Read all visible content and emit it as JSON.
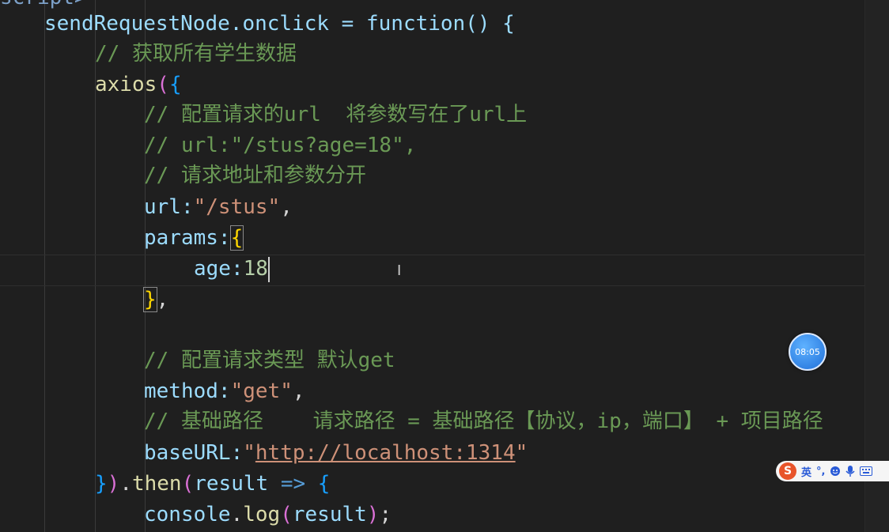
{
  "editor": {
    "l0": "sendRequestNode.onclick = function() {",
    "c1": "// 获取所有学生数据",
    "axios": "axios",
    "c2": "// 配置请求的url  将参数写在了url上",
    "c3": "// url:\"/stus?age=18\",",
    "c4": "// 请求地址和参数分开",
    "url_key": "url:",
    "url_val": "\"/stus\"",
    "params_key": "params:",
    "age_key": "age:",
    "age_val": "18",
    "c5": "// 配置请求类型 默认get",
    "method_key": "method:",
    "method_val": "\"get\"",
    "c6": "// 基础路径    请求路径 = 基础路径【协议，ip，端口】 + 项目路径",
    "base_key": "baseURL:",
    "base_q1": "\"",
    "base_link": "http://localhost:1314",
    "base_q2": "\"",
    "then_fn": "then",
    "result": "result",
    "arrow": "=>",
    "console": "console",
    "log": "log"
  },
  "timer": {
    "time": "08:05"
  },
  "ime": {
    "logo": "S",
    "lang": "英",
    "punct": "°,"
  }
}
